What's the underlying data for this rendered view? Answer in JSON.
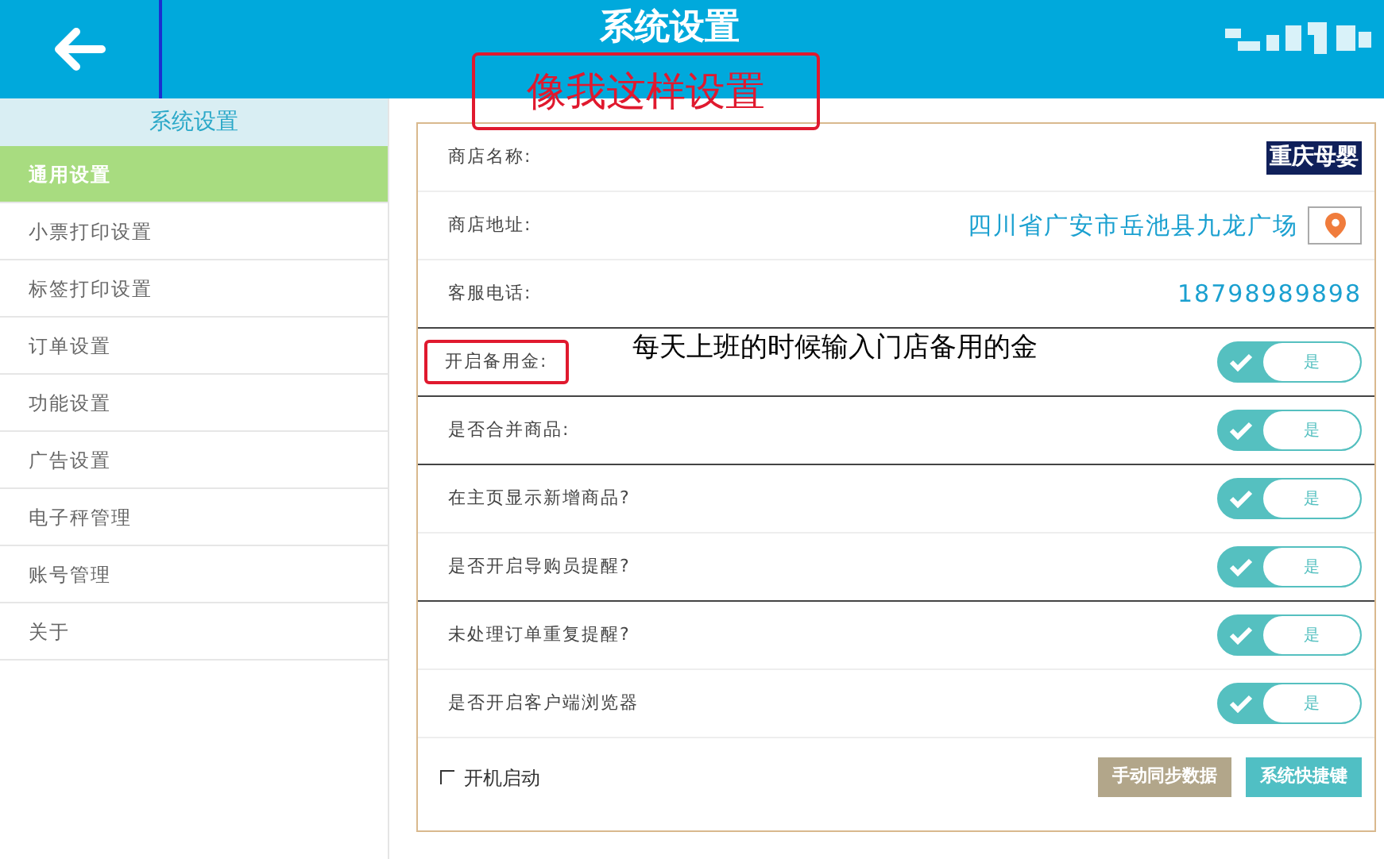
{
  "header": {
    "title": "系统设置"
  },
  "annotations": [
    {
      "kind": "boxed",
      "text": "像我这样设置"
    },
    {
      "kind": "plain",
      "text": "每天上班的时候输入门店备用的金"
    }
  ],
  "sidebar": {
    "title": "系统设置",
    "items": [
      {
        "label": "通用设置",
        "selected": true
      },
      {
        "label": "小票打印设置",
        "selected": false
      },
      {
        "label": "标签打印设置",
        "selected": false
      },
      {
        "label": "订单设置",
        "selected": false
      },
      {
        "label": "功能设置",
        "selected": false
      },
      {
        "label": "广告设置",
        "selected": false
      },
      {
        "label": "电子秤管理",
        "selected": false
      },
      {
        "label": "账号管理",
        "selected": false
      },
      {
        "label": "关于",
        "selected": false
      }
    ]
  },
  "settings": [
    {
      "kind": "text",
      "label": "商店名称:",
      "value": "重庆母婴",
      "highlighted": true,
      "strong_divider": false
    },
    {
      "kind": "location",
      "label": "商店地址:",
      "value": "四川省广安市岳池县九龙广场",
      "highlighted": false,
      "strong_divider": false
    },
    {
      "kind": "text",
      "label": "客服电话:",
      "value": "18798989898",
      "highlighted": false,
      "strong_divider": true
    },
    {
      "kind": "toggle",
      "label": "开启备用金:",
      "on": true,
      "option": "是",
      "annotated": true,
      "strong_divider": true
    },
    {
      "kind": "toggle",
      "label": "是否合并商品:",
      "on": true,
      "option": "是",
      "annotated": false,
      "strong_divider": true
    },
    {
      "kind": "toggle",
      "label": "在主页显示新增商品?",
      "on": true,
      "option": "是",
      "annotated": false,
      "strong_divider": false
    },
    {
      "kind": "toggle",
      "label": "是否开启导购员提醒?",
      "on": true,
      "option": "是",
      "annotated": false,
      "strong_divider": true
    },
    {
      "kind": "toggle",
      "label": "未处理订单重复提醒?",
      "on": true,
      "option": "是",
      "annotated": false,
      "strong_divider": false
    },
    {
      "kind": "toggle",
      "label": "是否开启客户端浏览器",
      "on": true,
      "option": "是",
      "annotated": false,
      "strong_divider": false
    }
  ],
  "autostart": {
    "label": "开机启动",
    "checked": false
  },
  "buttons": [
    {
      "kind": "secondary",
      "label": "手动同步数据"
    },
    {
      "kind": "primary",
      "label": "系统快捷键"
    }
  ]
}
